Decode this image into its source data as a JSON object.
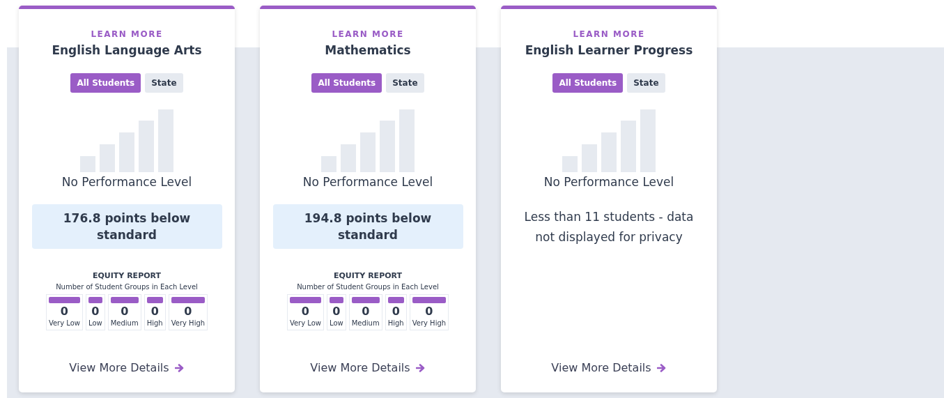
{
  "cards": [
    {
      "kind": "score",
      "link": "LEARN MORE",
      "title": "English Language Arts",
      "filters": [
        {
          "label": "All Students",
          "selected": true
        },
        {
          "label": "State",
          "selected": false
        }
      ],
      "performance": "No Performance Level",
      "status": "176.8 points below standard",
      "equity": {
        "title": "EQUITY REPORT",
        "subtitle": "Number of Student Groups in Each Level",
        "levels": [
          {
            "count": "0",
            "label": "Very Low"
          },
          {
            "count": "0",
            "label": "Low"
          },
          {
            "count": "0",
            "label": "Medium"
          },
          {
            "count": "0",
            "label": "High"
          },
          {
            "count": "0",
            "label": "Very High"
          }
        ]
      },
      "details": "View More Details"
    },
    {
      "kind": "score",
      "link": "LEARN MORE",
      "title": "Mathematics",
      "filters": [
        {
          "label": "All Students",
          "selected": true
        },
        {
          "label": "State",
          "selected": false
        }
      ],
      "performance": "No Performance Level",
      "status": "194.8 points below standard",
      "equity": {
        "title": "EQUITY REPORT",
        "subtitle": "Number of Student Groups in Each Level",
        "levels": [
          {
            "count": "0",
            "label": "Very Low"
          },
          {
            "count": "0",
            "label": "Low"
          },
          {
            "count": "0",
            "label": "Medium"
          },
          {
            "count": "0",
            "label": "High"
          },
          {
            "count": "0",
            "label": "Very High"
          }
        ]
      },
      "details": "View More Details"
    },
    {
      "kind": "suppressed",
      "link": "LEARN MORE",
      "title": "English Learner Progress",
      "filters": [
        {
          "label": "All Students",
          "selected": true
        },
        {
          "label": "State",
          "selected": false
        }
      ],
      "performance": "No Performance Level",
      "status": "Less than 11 students - data not displayed for privacy",
      "details": "View More Details"
    }
  ]
}
